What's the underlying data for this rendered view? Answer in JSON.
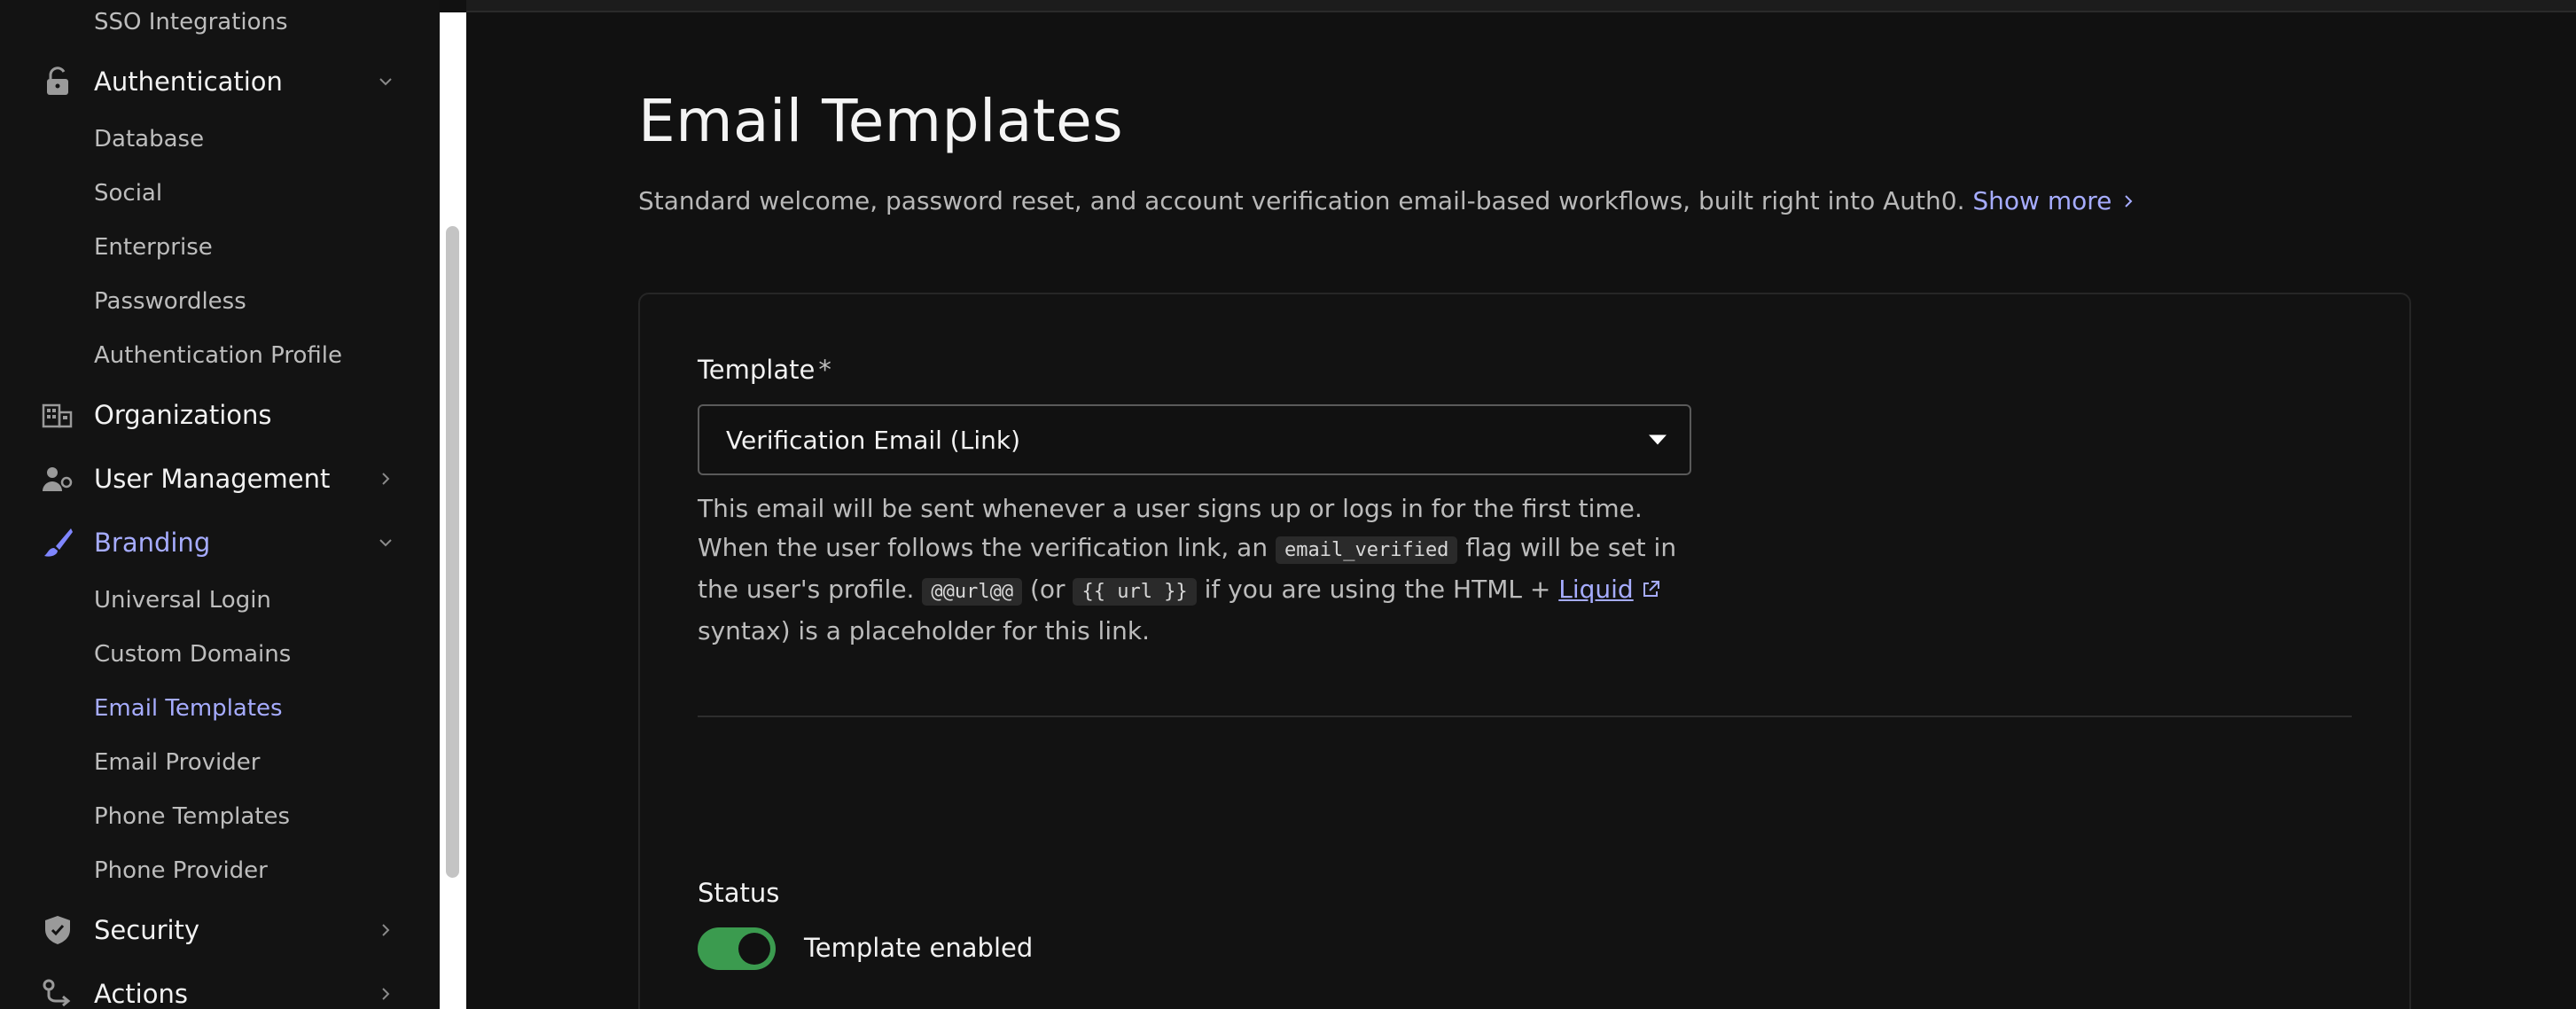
{
  "sidebar": {
    "sso_integrations": "SSO Integrations",
    "authentication": {
      "label": "Authentication",
      "items": [
        "Database",
        "Social",
        "Enterprise",
        "Passwordless",
        "Authentication Profile"
      ]
    },
    "organizations": "Organizations",
    "user_management": "User Management",
    "branding": {
      "label": "Branding",
      "items": [
        "Universal Login",
        "Custom Domains",
        "Email Templates",
        "Email Provider",
        "Phone Templates",
        "Phone Provider"
      ],
      "active_item": "Email Templates"
    },
    "security": "Security",
    "actions": "Actions"
  },
  "page": {
    "title": "Email Templates",
    "description": "Standard welcome, password reset, and account verification email-based workflows, built right into Auth0.",
    "show_more": "Show more"
  },
  "template": {
    "label": "Template",
    "required_mark": "*",
    "selected": "Verification Email (Link)",
    "help": {
      "part1": "This email will be sent whenever a user signs up or logs in for the first time. When the user follows the verification link, an",
      "code1": "email_verified",
      "part2": "flag will be set in the user's profile.",
      "code2": "@@url@@",
      "part3": "(or",
      "code3": "{{ url }}",
      "part4": "if you are using the HTML +",
      "link": "Liquid",
      "part5": "syntax) is a placeholder for this link."
    }
  },
  "status": {
    "label": "Status",
    "toggle_label": "Template enabled",
    "enabled": true
  },
  "colors": {
    "accent": "#a6acff",
    "toggle_on": "#3b9b4f",
    "background": "#111111"
  }
}
